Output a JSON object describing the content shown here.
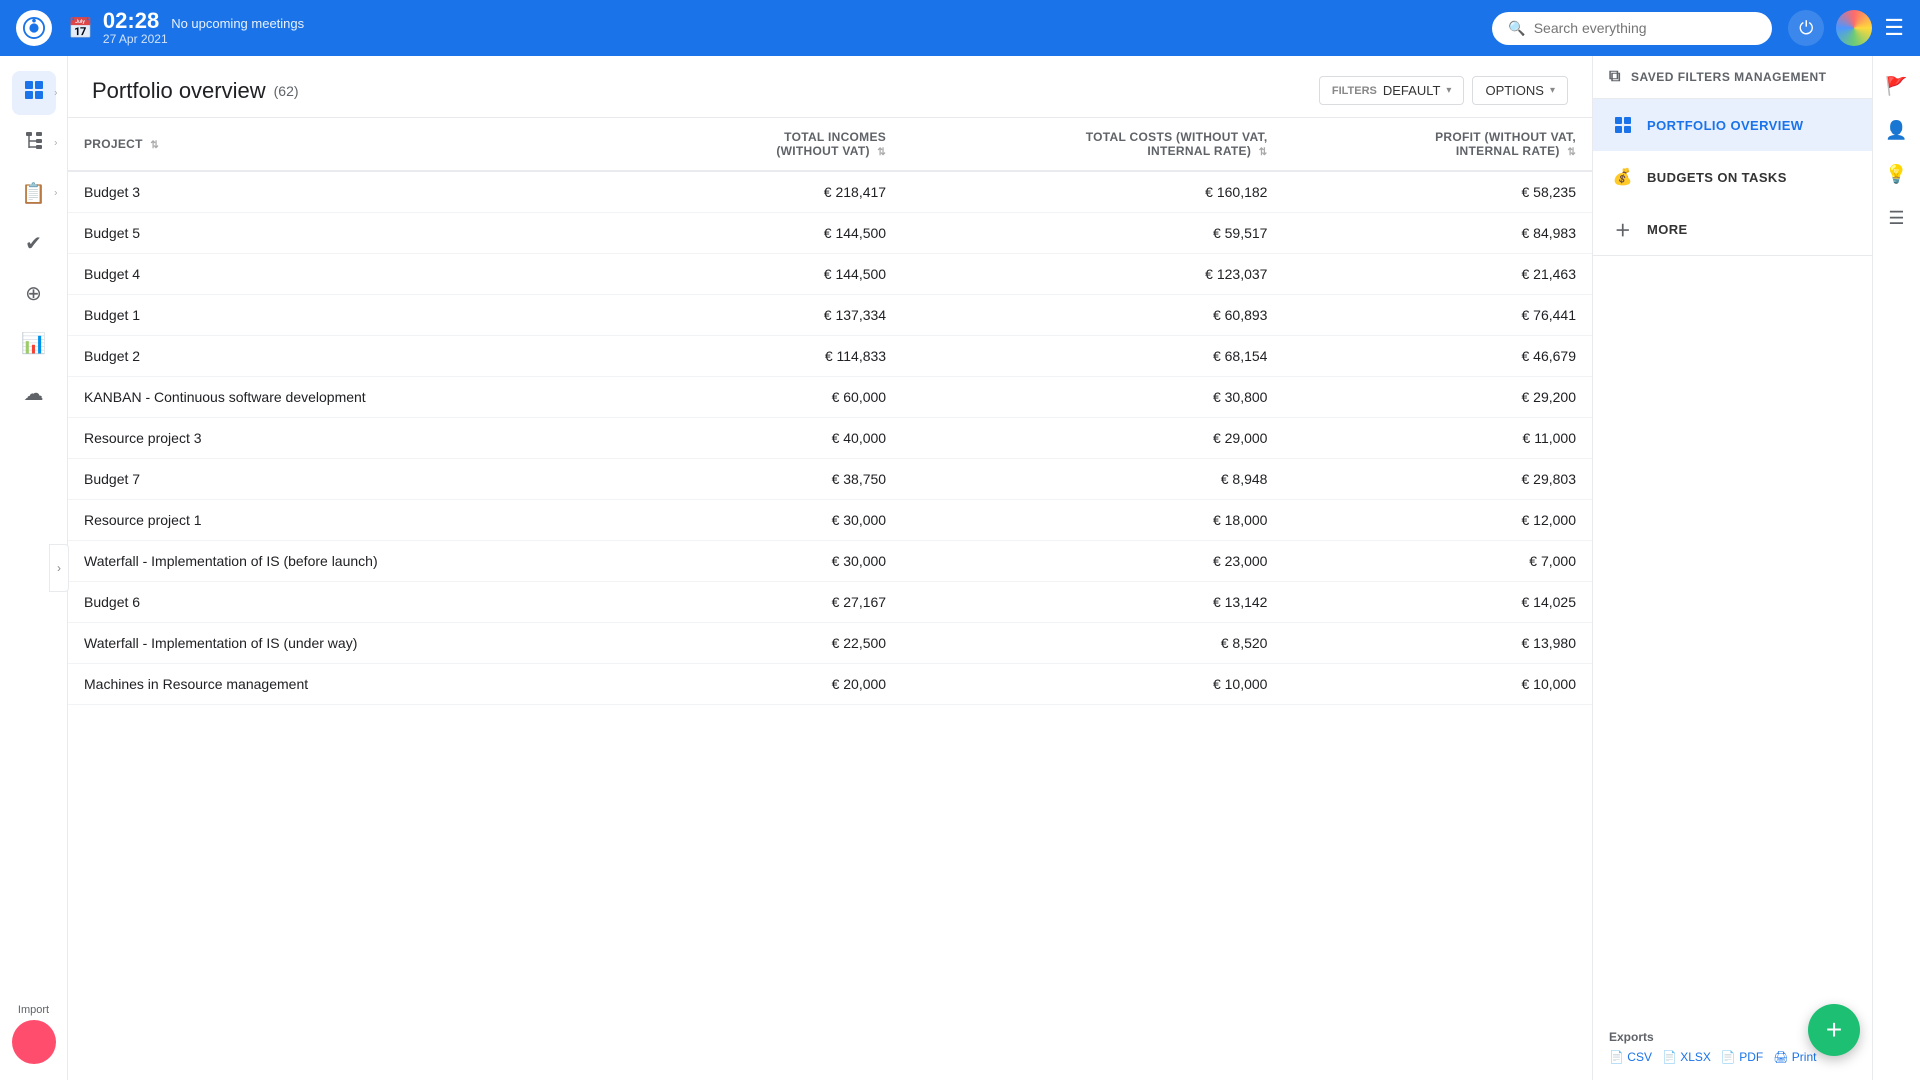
{
  "topbar": {
    "time": "02:28",
    "meeting": "No upcoming meetings",
    "date": "27 Apr 2021",
    "search_placeholder": "Search everything"
  },
  "sidebar": {
    "items": [
      {
        "id": "grid",
        "icon": "⊞",
        "active": true
      },
      {
        "id": "tree",
        "icon": "≡"
      },
      {
        "id": "clipboard",
        "icon": "📋"
      },
      {
        "id": "checkmark",
        "icon": "✔"
      },
      {
        "id": "target",
        "icon": "⊕"
      },
      {
        "id": "chart",
        "icon": "📊"
      },
      {
        "id": "cloud",
        "icon": "☁"
      }
    ],
    "import_label": "Import"
  },
  "page": {
    "title": "Portfolio overview",
    "count": "(62)",
    "filters_label": "FILTERS",
    "filters_value": "DEFAULT",
    "options_label": "OPTIONS"
  },
  "table": {
    "columns": [
      {
        "id": "project",
        "label": "PROJECT",
        "sortable": true
      },
      {
        "id": "total_incomes",
        "label": "TOTAL INCOMES (WITHOUT VAT)",
        "sortable": true,
        "align": "right"
      },
      {
        "id": "total_costs",
        "label": "TOTAL COSTS (WITHOUT VAT, INTERNAL RATE)",
        "sortable": true,
        "align": "right"
      },
      {
        "id": "profit",
        "label": "PROFIT (WITHOUT VAT, INTERNAL RATE)",
        "sortable": true,
        "align": "right"
      }
    ],
    "rows": [
      {
        "project": "Budget 3",
        "total_incomes": "€ 218,417",
        "total_costs": "€ 160,182",
        "profit": "€ 58,235"
      },
      {
        "project": "Budget 5",
        "total_incomes": "€ 144,500",
        "total_costs": "€ 59,517",
        "profit": "€ 84,983"
      },
      {
        "project": "Budget 4",
        "total_incomes": "€ 144,500",
        "total_costs": "€ 123,037",
        "profit": "€ 21,463"
      },
      {
        "project": "Budget 1",
        "total_incomes": "€ 137,334",
        "total_costs": "€ 60,893",
        "profit": "€ 76,441"
      },
      {
        "project": "Budget 2",
        "total_incomes": "€ 114,833",
        "total_costs": "€ 68,154",
        "profit": "€ 46,679"
      },
      {
        "project": "KANBAN - Continuous software development",
        "total_incomes": "€ 60,000",
        "total_costs": "€ 30,800",
        "profit": "€ 29,200"
      },
      {
        "project": "Resource project 3",
        "total_incomes": "€ 40,000",
        "total_costs": "€ 29,000",
        "profit": "€ 11,000"
      },
      {
        "project": "Budget 7",
        "total_incomes": "€ 38,750",
        "total_costs": "€ 8,948",
        "profit": "€ 29,803"
      },
      {
        "project": "Resource project 1",
        "total_incomes": "€ 30,000",
        "total_costs": "€ 18,000",
        "profit": "€ 12,000"
      },
      {
        "project": "Waterfall - Implementation of IS (before launch)",
        "total_incomes": "€ 30,000",
        "total_costs": "€ 23,000",
        "profit": "€ 7,000"
      },
      {
        "project": "Budget 6",
        "total_incomes": "€ 27,167",
        "total_costs": "€ 13,142",
        "profit": "€ 14,025"
      },
      {
        "project": "Waterfall - Implementation of IS (under way)",
        "total_incomes": "€ 22,500",
        "total_costs": "€ 8,520",
        "profit": "€ 13,980"
      },
      {
        "project": "Machines in Resource management",
        "total_incomes": "€ 20,000",
        "total_costs": "€ 10,000",
        "profit": "€ 10,000"
      }
    ]
  },
  "right_panel": {
    "saved_filters_label": "SAVED FILTERS MANAGEMENT",
    "portfolio_overview_label": "PORTFOLIO OVERVIEW",
    "budgets_on_tasks_label": "BUDGETS ON TASKS",
    "more_label": "MORE",
    "exports": {
      "title": "Exports",
      "links": [
        "CSV",
        "XLSX",
        "PDF",
        "Print"
      ]
    }
  },
  "fab": {
    "icon": "+"
  }
}
